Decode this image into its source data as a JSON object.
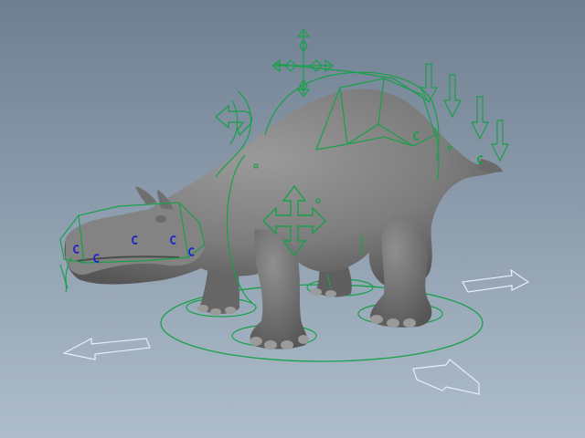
{
  "viewport": {
    "background_top": "#6f7f91",
    "background_bottom": "#aebdcb",
    "mesh_color": "#7d7d7d",
    "mesh_shadow": "#5a5a5a",
    "mesh_highlight": "#9a9a9a",
    "rig_color": "#18a04a",
    "selected_color": "#1c22c8",
    "move_arrow_color": "#e8eef5"
  },
  "icons": {
    "move_manipulator": "four-way-arrow-icon",
    "rotate_manipulator": "curved-arrow-icon",
    "tail_control": "down-arrow-icon",
    "floor_direction": "flat-arrow-icon"
  }
}
